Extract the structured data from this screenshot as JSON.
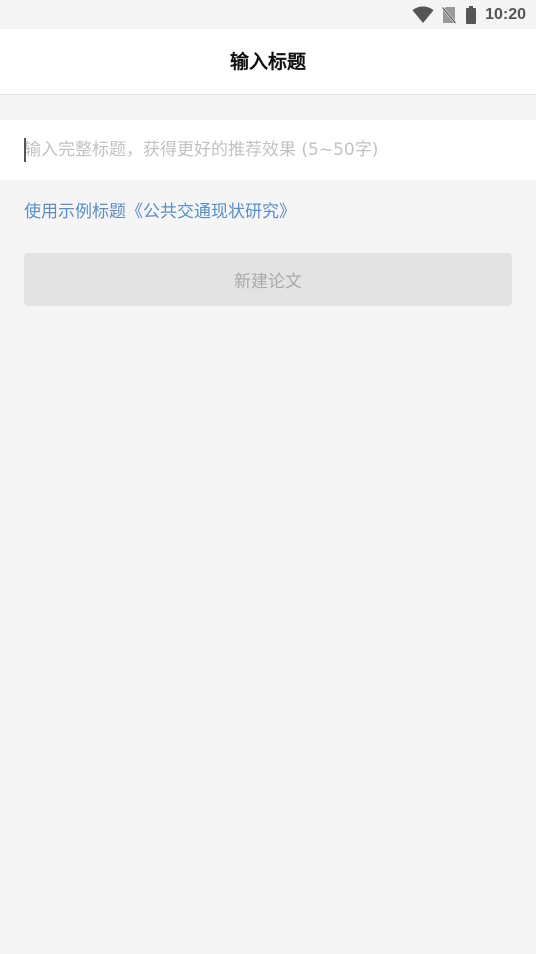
{
  "status_bar": {
    "time": "10:20",
    "icons": [
      "wifi-icon",
      "no-sim-icon",
      "battery-icon"
    ]
  },
  "header": {
    "title": "输入标题"
  },
  "title_input": {
    "value": "",
    "placeholder": "输入完整标题，获得更好的推荐效果 (5~50字)"
  },
  "example_link": {
    "label": "使用示例标题《公共交通现状研究》"
  },
  "create_button": {
    "label": "新建论文",
    "enabled": false
  },
  "colors": {
    "background": "#f5f5f5",
    "link": "#5b8ec4",
    "button_disabled_bg": "#e3e3e3",
    "button_disabled_text": "#a9a9a9",
    "placeholder": "#c2c2c2"
  }
}
